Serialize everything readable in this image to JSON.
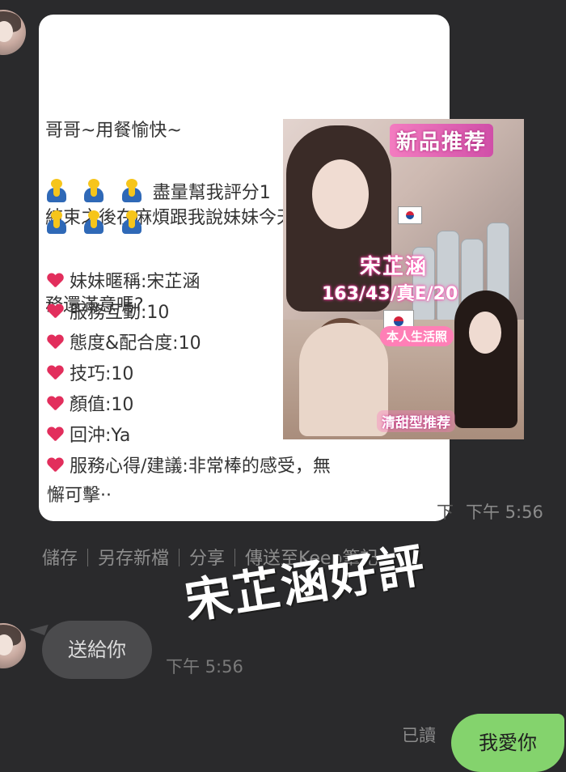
{
  "message": {
    "lines": [
      "哥哥~用餐愉快~",
      "結束之後在麻煩跟我說妹妹今天的服",
      "務還滿意嗎?"
    ],
    "rating_request": "盡量幫我評分1",
    "ratings": [
      {
        "label": "妹妹暱稱:宋芷涵"
      },
      {
        "label": "服務互動:10"
      },
      {
        "label": "態度&配合度:10"
      },
      {
        "label": "技巧:10"
      },
      {
        "label": "顏值:10"
      },
      {
        "label": "回沖:Ya"
      },
      {
        "label": "服務心得/建議:非常棒的感受，無"
      }
    ],
    "rating_tail": "懈可擊··",
    "time": "下午 5:56",
    "time_faint": "下"
  },
  "promo": {
    "badge": "新品推荐",
    "name": "宋芷涵",
    "stats": "163/43/真E/20",
    "life_label": "本人生活照",
    "type_label": "清甜型推荐",
    "flag_color_top": "#d3223c",
    "flag_color_bottom": "#1f4ea0"
  },
  "actions": [
    "儲存",
    "另存新檔",
    "分享",
    "傳送至Keep筆記"
  ],
  "stamp": "宋芷涵好評",
  "chat2": {
    "left_bubble": "送給你",
    "left_time": "下午 5:56",
    "read_label": "已讀",
    "right_bubble": "我愛你"
  },
  "colors": {
    "background": "#2a2a2c",
    "received_bubble": "#4b4b4d",
    "sent_bubble": "#84d36d",
    "heart": "#e22e5c"
  }
}
